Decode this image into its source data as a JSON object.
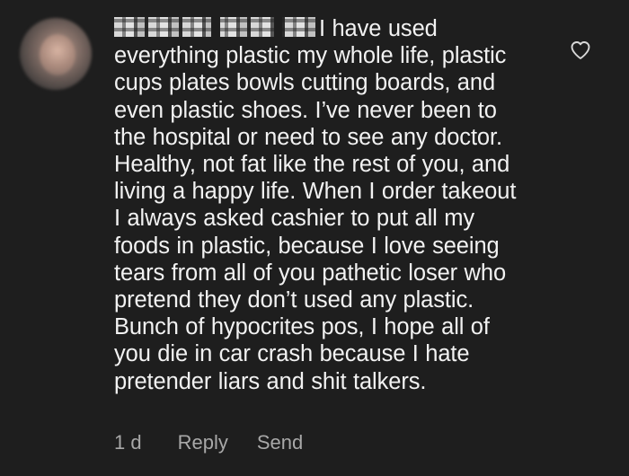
{
  "comment": {
    "lines": [
      "I have used",
      "everything plastic my whole life, plastic",
      "cups plates bowls cutting boards, and",
      "even plastic shoes. I’ve never been to",
      "the hospital or need to see any doctor.",
      "Healthy, not fat like the rest of you, and",
      "living a happy life. When I order takeout",
      "I always asked cashier to put all my",
      "foods in plastic, because I love seeing",
      "tears from all of you pathetic loser who",
      "pretend they don’t used any plastic.",
      "Bunch of hypocrites pos, I hope all of",
      "you die in car crash because I hate",
      "pretender liars and shit talkers."
    ],
    "time": "1 d",
    "reply_label": "Reply",
    "send_label": "Send"
  },
  "icons": {
    "like": "heart-outline-icon"
  },
  "colors": {
    "background": "#1e1e1e",
    "text": "#f2f2f2",
    "meta": "#a8a8a8"
  }
}
